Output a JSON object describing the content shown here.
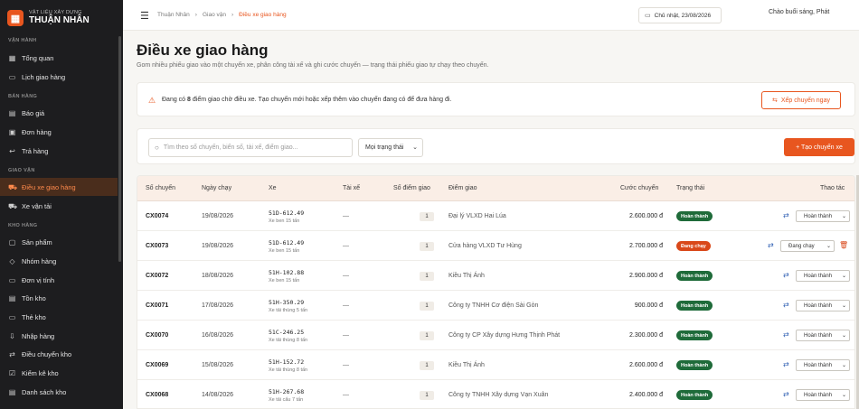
{
  "brand": {
    "sub": "VẬT LIỆU XÂY DỰNG",
    "name": "THUẬN NHÂN"
  },
  "sidebar": {
    "groups": [
      {
        "label": "VẬN HÀNH",
        "items": [
          {
            "label": "Tổng quan",
            "icon": "grid-icon"
          },
          {
            "label": "Lịch giao hàng",
            "icon": "calendar-icon"
          }
        ]
      },
      {
        "label": "BÁN HÀNG",
        "items": [
          {
            "label": "Báo giá",
            "icon": "document-icon"
          },
          {
            "label": "Đơn hàng",
            "icon": "cart-icon"
          },
          {
            "label": "Trả hàng",
            "icon": "return-icon"
          }
        ]
      },
      {
        "label": "GIAO VẬN",
        "items": [
          {
            "label": "Điều xe giao hàng",
            "icon": "truck-icon",
            "active": true
          },
          {
            "label": "Xe vận tải",
            "icon": "truck-icon"
          }
        ]
      },
      {
        "label": "KHO HÀNG",
        "items": [
          {
            "label": "Sản phẩm",
            "icon": "box-icon"
          },
          {
            "label": "Nhóm hàng",
            "icon": "tag-icon"
          },
          {
            "label": "Đơn vị tính",
            "icon": "ruler-icon"
          },
          {
            "label": "Tồn kho",
            "icon": "warehouse-icon"
          },
          {
            "label": "Thẻ kho",
            "icon": "card-icon"
          },
          {
            "label": "Nhập hàng",
            "icon": "import-icon"
          },
          {
            "label": "Điều chuyển kho",
            "icon": "transfer-icon"
          },
          {
            "label": "Kiểm kê kho",
            "icon": "checklist-icon"
          },
          {
            "label": "Danh sách kho",
            "icon": "list-icon"
          }
        ]
      }
    ]
  },
  "topbar": {
    "breadcrumb": [
      "Thuận Nhân",
      "Giao vận",
      "Điều xe giao hàng"
    ],
    "date": "Chủ nhật, 23/08/2026",
    "greeting": "Chào buổi sáng, Phát"
  },
  "page": {
    "title": "Điều xe giao hàng",
    "subtitle": "Gom nhiều phiếu giao vào một chuyến xe, phân công tài xế và ghi cước chuyến — trạng thái phiếu giao tự chạy theo chuyến."
  },
  "alert": {
    "prefix": "Đang có ",
    "count": "8",
    "suffix": " điểm giao chờ điều xe. Tạo chuyến mới hoặc xếp thêm vào chuyến đang có để đưa hàng đi.",
    "button": "Xếp chuyến ngay"
  },
  "filters": {
    "search_placeholder": "Tìm theo số chuyến, biển số, tài xế, điểm giao...",
    "status_select": "Mọi trạng thái",
    "create_button": "+  Tạo chuyến xe"
  },
  "table": {
    "headers": [
      "Số chuyến",
      "Ngày chạy",
      "Xe",
      "Tài xế",
      "Số điểm giao",
      "Điểm giao",
      "Cước chuyến",
      "Trạng thái",
      "Thao tác"
    ],
    "rows": [
      {
        "id": "CX0074",
        "date": "19/08/2026",
        "plate": "51D-612.49",
        "vehicle": "Xe ben 15 tấn",
        "driver": "—",
        "count": "1",
        "dest": "Đại lý VLXD Hai Lúa",
        "fee": "2.600.000 đ",
        "status": "Hoàn thành",
        "action": "Hoàn thành"
      },
      {
        "id": "CX0073",
        "date": "19/08/2026",
        "plate": "51D-612.49",
        "vehicle": "Xe ben 15 tấn",
        "driver": "—",
        "count": "1",
        "dest": "Cửa hàng VLXD Tư Hùng",
        "fee": "2.700.000 đ",
        "status": "Đang chạy",
        "action": "Đang chạy"
      },
      {
        "id": "CX0072",
        "date": "18/08/2026",
        "plate": "51H-102.88",
        "vehicle": "Xe ben 15 tấn",
        "driver": "—",
        "count": "1",
        "dest": "Kiều Thị Ánh",
        "fee": "2.900.000 đ",
        "status": "Hoàn thành",
        "action": "Hoàn thành"
      },
      {
        "id": "CX0071",
        "date": "17/08/2026",
        "plate": "51H-350.29",
        "vehicle": "Xe tải thùng 5 tấn",
        "driver": "—",
        "count": "1",
        "dest": "Công ty TNHH Cơ điện Sài Gòn",
        "fee": "900.000 đ",
        "status": "Hoàn thành",
        "action": "Hoàn thành"
      },
      {
        "id": "CX0070",
        "date": "16/08/2026",
        "plate": "51C-246.25",
        "vehicle": "Xe tải thùng 8 tấn",
        "driver": "—",
        "count": "1",
        "dest": "Công ty CP Xây dựng Hưng Thịnh Phát",
        "fee": "2.300.000 đ",
        "status": "Hoàn thành",
        "action": "Hoàn thành"
      },
      {
        "id": "CX0069",
        "date": "15/08/2026",
        "plate": "51H-152.72",
        "vehicle": "Xe tải thùng 8 tấn",
        "driver": "—",
        "count": "1",
        "dest": "Kiều Thị Ánh",
        "fee": "2.600.000 đ",
        "status": "Hoàn thành",
        "action": "Hoàn thành"
      },
      {
        "id": "CX0068",
        "date": "14/08/2026",
        "plate": "51H-267.68",
        "vehicle": "Xe tải cẩu 7 tấn",
        "driver": "—",
        "count": "1",
        "dest": "Công ty TNHH Xây dựng Vạn Xuân",
        "fee": "2.400.000 đ",
        "status": "Hoàn thành",
        "action": "Hoàn thành"
      }
    ]
  },
  "colors": {
    "accent": "#e8561f",
    "sidebar_bg": "#1d1d1f",
    "status_done": "#1f6b3a",
    "status_running": "#d9481a"
  }
}
